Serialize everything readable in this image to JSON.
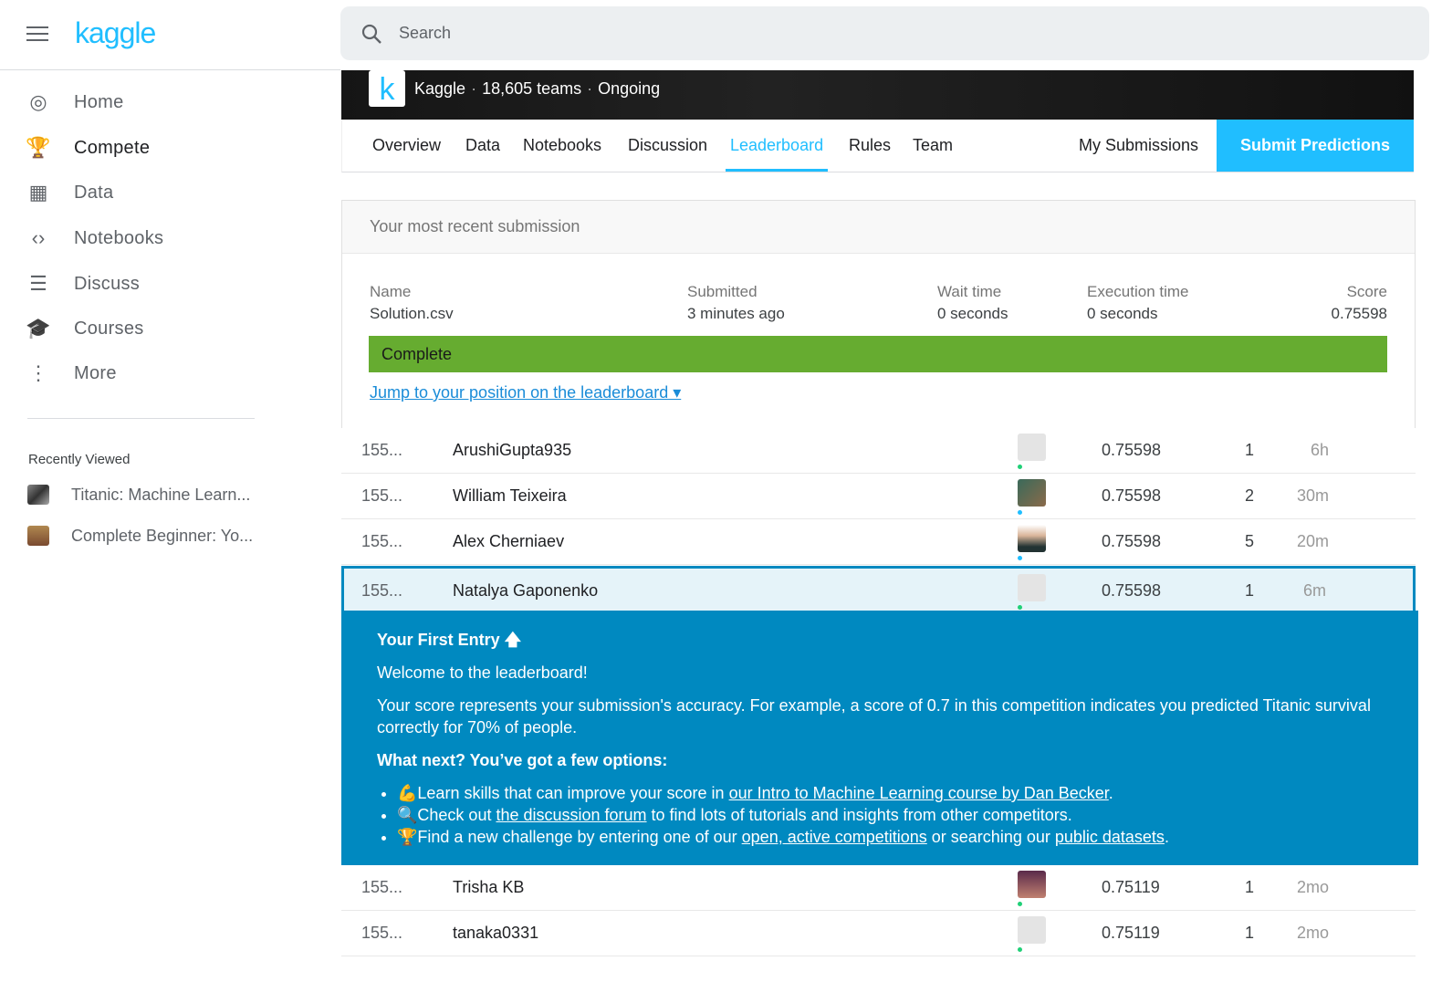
{
  "app": {
    "logo": "kaggle"
  },
  "search": {
    "placeholder": "Search"
  },
  "sidebar": {
    "items": [
      {
        "label": "Home",
        "icon": "compass-icon",
        "glyph": "◎"
      },
      {
        "label": "Compete",
        "icon": "trophy-icon",
        "glyph": "🏆"
      },
      {
        "label": "Data",
        "icon": "table-icon",
        "glyph": "▦"
      },
      {
        "label": "Notebooks",
        "icon": "code-icon",
        "glyph": "‹›"
      },
      {
        "label": "Discuss",
        "icon": "comment-icon",
        "glyph": "☰"
      },
      {
        "label": "Courses",
        "icon": "graduation-cap-icon",
        "glyph": "🎓"
      },
      {
        "label": "More",
        "icon": "more-vert-icon",
        "glyph": "⋮"
      }
    ],
    "active": "Compete",
    "recently_viewed_title": "Recently Viewed",
    "recent": [
      {
        "label": "Titanic: Machine Learn..."
      },
      {
        "label": "Complete Beginner: Yo..."
      }
    ]
  },
  "banner": {
    "host": "Kaggle",
    "teams": "18,605 teams",
    "status": "Ongoing"
  },
  "tabs": [
    {
      "label": "Overview"
    },
    {
      "label": "Data"
    },
    {
      "label": "Notebooks"
    },
    {
      "label": "Discussion"
    },
    {
      "label": "Leaderboard"
    },
    {
      "label": "Rules"
    },
    {
      "label": "Team"
    }
  ],
  "active_tab": "Leaderboard",
  "my_submissions": "My Submissions",
  "submit_predictions": "Submit Predictions",
  "submission": {
    "title": "Your most recent submission",
    "columns": [
      {
        "h": "Name",
        "v": "Solution.csv"
      },
      {
        "h": "Submitted",
        "v": "3 minutes ago"
      },
      {
        "h": "Wait time",
        "v": "0 seconds"
      },
      {
        "h": "Execution time",
        "v": "0 seconds"
      },
      {
        "h": "Score",
        "v": "0.75598"
      }
    ],
    "status": "Complete",
    "status_color": "#66ac30",
    "jump": "Jump to your position on the leaderboard ▾"
  },
  "leaderboard": [
    {
      "rank": "155...",
      "name": "ArushiGupta935",
      "score": "0.75598",
      "entries": "1",
      "last": "6h"
    },
    {
      "rank": "155...",
      "name": "William Teixeira",
      "score": "0.75598",
      "entries": "2",
      "last": "30m"
    },
    {
      "rank": "155...",
      "name": "Alex Cherniaev",
      "score": "0.75598",
      "entries": "5",
      "last": "20m"
    },
    {
      "rank": "155...",
      "name": "Natalya Gaponenko",
      "score": "0.75598",
      "entries": "1",
      "last": "6m"
    },
    {
      "rank": "155...",
      "name": "Trisha KB",
      "score": "0.75119",
      "entries": "1",
      "last": "2mo"
    },
    {
      "rank": "155...",
      "name": "tanaka0331",
      "score": "0.75119",
      "entries": "1",
      "last": "2mo"
    }
  ],
  "first_entry": {
    "title": "Your First Entry 🡅",
    "welcome": "Welcome to the leaderboard!",
    "desc": "Your score represents your submission's accuracy. For example, a score of 0.7 in this competition indicates you predicted Titanic survival correctly for 70% of people.",
    "next": "What next? You’ve got a few options:",
    "opt1_pre": "💪Learn skills that can improve your score in ",
    "opt1_link": "our Intro to Machine Learning course by Dan Becker",
    "opt1_post": ".",
    "opt2_pre": "🔍Check out ",
    "opt2_link": "the discussion forum",
    "opt2_post": " to find lots of tutorials and insights from other competitors.",
    "opt3_pre": "🏆Find a new challenge by entering one of our ",
    "opt3_link": "open, active competitions",
    "opt3_mid": " or searching our ",
    "opt3_link2": "public datasets",
    "opt3_post": "."
  },
  "colors": {
    "accent": "#20beff",
    "highlight": "#0089c0"
  }
}
